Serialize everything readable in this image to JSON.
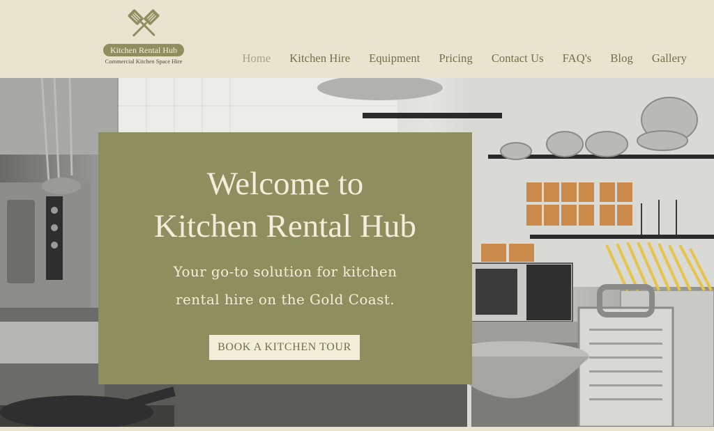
{
  "brand": {
    "name": "Kitchen Rental Hub",
    "tagline": "Commercial Kitchen Space Hire",
    "icon": "crossed-spatulas-icon"
  },
  "nav": {
    "items": [
      {
        "label": "Home",
        "active": true
      },
      {
        "label": "Kitchen Hire",
        "active": false
      },
      {
        "label": "Equipment",
        "active": false
      },
      {
        "label": "Pricing",
        "active": false
      },
      {
        "label": "Contact Us",
        "active": false
      },
      {
        "label": "FAQ's",
        "active": false
      },
      {
        "label": "Blog",
        "active": false
      },
      {
        "label": "Gallery",
        "active": false
      }
    ]
  },
  "hero": {
    "title_line1": "Welcome to",
    "title_line2": "Kitchen Rental Hub",
    "subtitle_line1": "Your go-to solution for kitchen",
    "subtitle_line2": "rental hire on the Gold Coast.",
    "cta_label": "BOOK A KITCHEN TOUR",
    "background": "commercial-kitchen-photo"
  },
  "colors": {
    "header_bg": "#e8e4d0",
    "accent_olive": "#8d8f5f",
    "nav_text": "#6f7148",
    "nav_active": "#a3a48a",
    "cream": "#f2eed9"
  }
}
